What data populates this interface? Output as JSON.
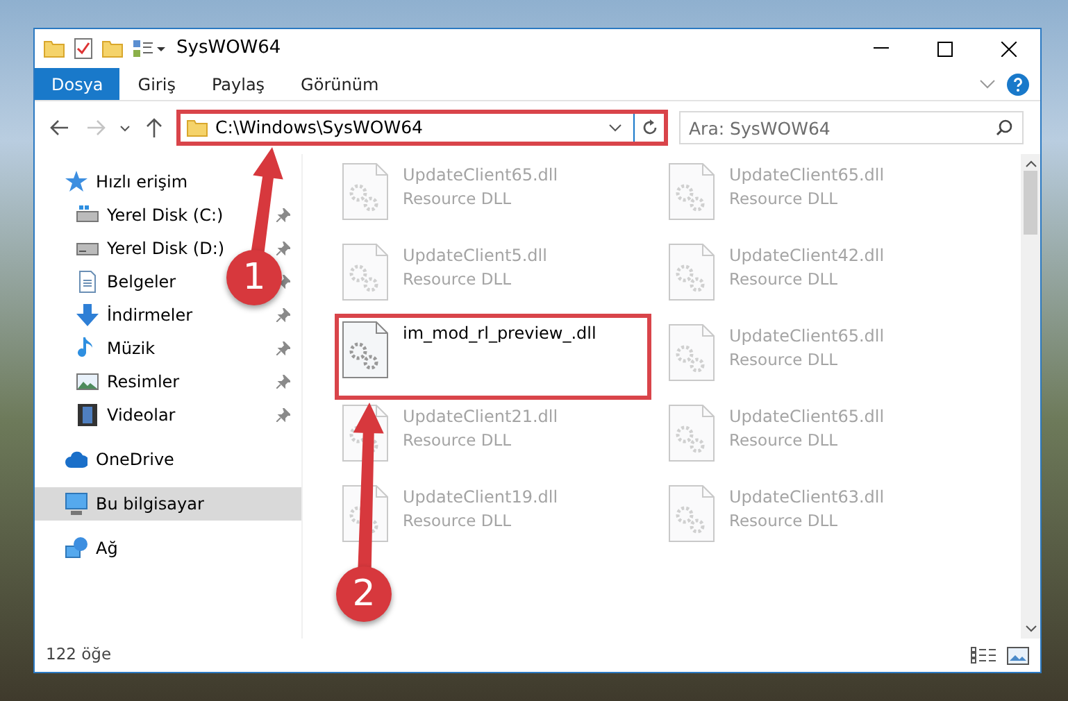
{
  "window": {
    "title": "SysWOW64"
  },
  "ribbon_tabs": [
    {
      "label": "Dosya",
      "selected": true
    },
    {
      "label": "Giriş",
      "selected": false
    },
    {
      "label": "Paylaş",
      "selected": false
    },
    {
      "label": "Görünüm",
      "selected": false
    }
  ],
  "address": {
    "path": "C:\\Windows\\SysWOW64",
    "highlighted": true
  },
  "search": {
    "placeholder": "Ara: SysWOW64"
  },
  "sidebar": {
    "items": [
      {
        "label": "Hızlı erişim",
        "selected": false,
        "children": [
          {
            "label": "Yerel Disk (C:)",
            "selected": false,
            "pinned": true
          },
          {
            "label": "Yerel Disk (D:)",
            "selected": false,
            "pinned": true
          },
          {
            "label": "Belgeler",
            "selected": false,
            "pinned": true
          },
          {
            "label": "İndirmeler",
            "selected": false,
            "pinned": true
          },
          {
            "label": "Müzik",
            "selected": false,
            "pinned": true
          },
          {
            "label": "Resimler",
            "selected": false,
            "pinned": true
          },
          {
            "label": "Videolar",
            "selected": false,
            "pinned": true
          }
        ]
      },
      {
        "label": "OneDrive",
        "selected": false
      },
      {
        "label": "Bu bilgisayar",
        "selected": true
      },
      {
        "label": "Ağ",
        "selected": false
      }
    ]
  },
  "files": [
    {
      "name": "UpdateClient65.dll",
      "type": "Resource DLL",
      "faded": true,
      "highlighted": false
    },
    {
      "name": "UpdateClient65.dll",
      "type": "Resource DLL",
      "faded": true,
      "highlighted": false
    },
    {
      "name": "UpdateClient5.dll",
      "type": "Resource DLL",
      "faded": true,
      "highlighted": false
    },
    {
      "name": "UpdateClient42.dll",
      "type": "Resource DLL",
      "faded": true,
      "highlighted": false
    },
    {
      "name": "im_mod_rl_preview_.dll",
      "faded": false,
      "highlighted": true
    },
    {
      "name": "UpdateClient65.dll",
      "type": "Resource DLL",
      "faded": true,
      "highlighted": false
    },
    {
      "name": "UpdateClient21.dll",
      "type": "Resource DLL",
      "faded": true,
      "highlighted": false
    },
    {
      "name": "UpdateClient65.dll",
      "type": "Resource DLL",
      "faded": true,
      "highlighted": false
    },
    {
      "name": "UpdateClient19.dll",
      "type": "Resource DLL",
      "faded": true,
      "highlighted": false
    },
    {
      "name": "UpdateClient63.dll",
      "type": "Resource DLL",
      "faded": true,
      "highlighted": false
    }
  ],
  "status_bar": {
    "count": "122 öğe"
  },
  "annotations": [
    {
      "number": "1"
    },
    {
      "number": "2"
    }
  ]
}
